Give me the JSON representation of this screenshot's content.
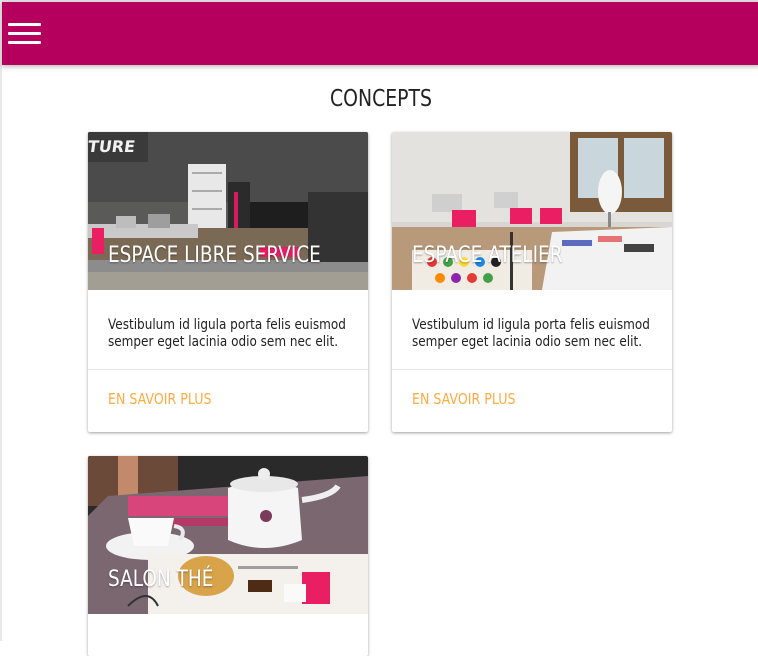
{
  "header": {
    "menu_icon": "hamburger-menu-icon",
    "bar_color": "#b5005e"
  },
  "section": {
    "title": "CONCEPTS"
  },
  "accent_color": "#ffab40",
  "cards": [
    {
      "title": "ESPACE LIBRE SERVICE",
      "text": "Vestibulum id ligula porta felis euismod semper eget lacinia odio sem nec elit.",
      "action": "EN SAVOIR PLUS",
      "image": "workshop-room-photo"
    },
    {
      "title": "ESPACE ATELIER",
      "text": "Vestibulum id ligula porta felis euismod semper eget lacinia odio sem nec elit.",
      "action": "EN SAVOIR PLUS",
      "image": "atelier-sewing-room-photo"
    },
    {
      "title": "SALON THÉ",
      "image": "tea-set-photo"
    }
  ]
}
